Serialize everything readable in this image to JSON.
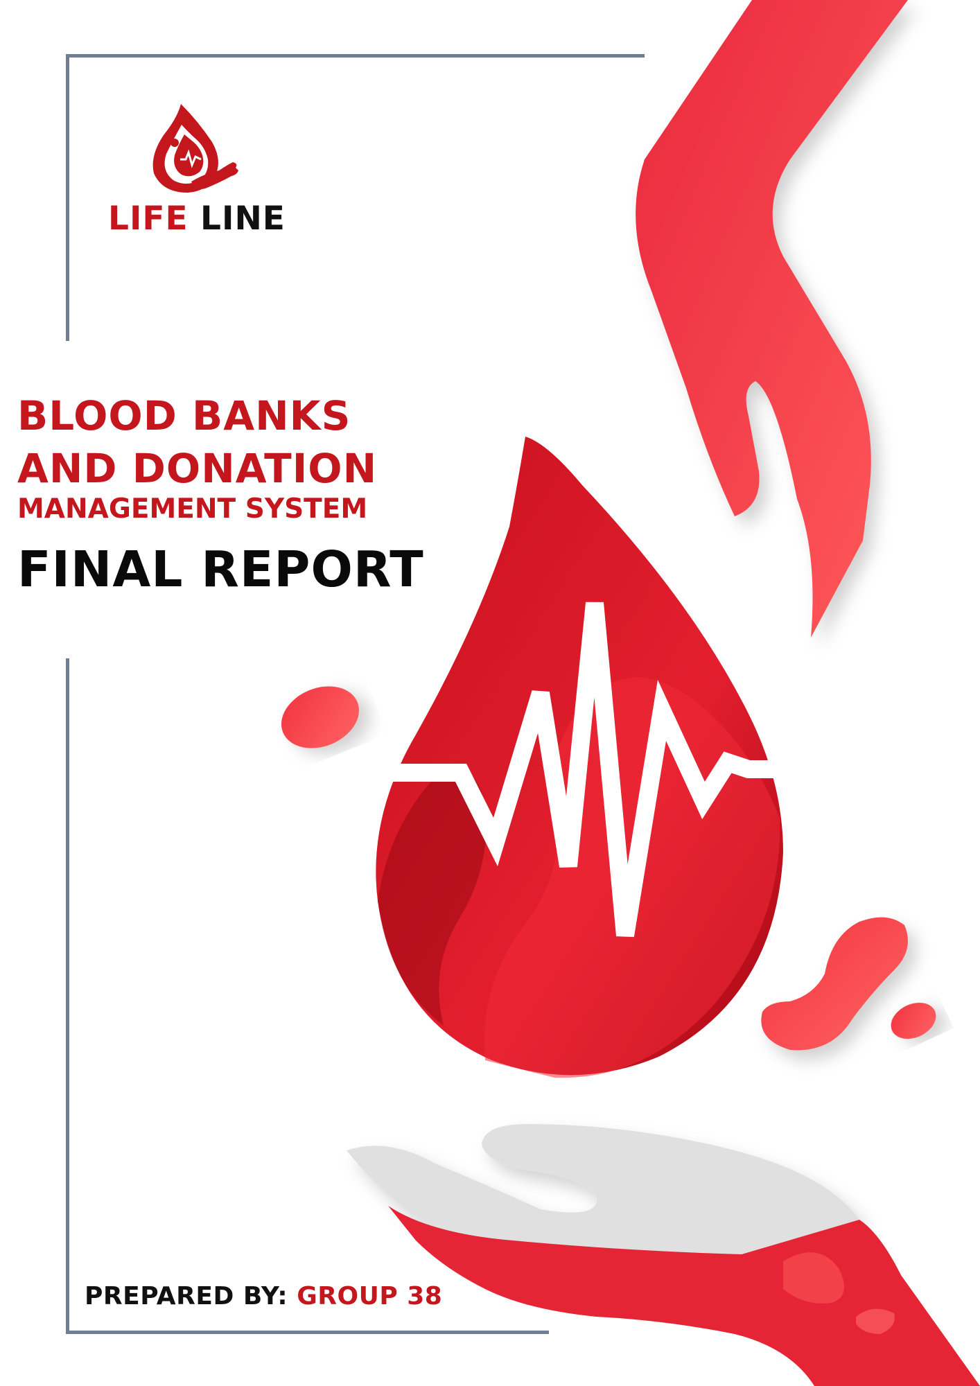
{
  "logo": {
    "word_1": "LIFE",
    "word_2": "LINE"
  },
  "title": {
    "line_1": "BLOOD BANKS",
    "line_2": "AND DONATION",
    "line_3": "MANAGEMENT SYSTEM"
  },
  "report_title": "FINAL REPORT",
  "prepared": {
    "label": "PREPARED BY:",
    "group": "GROUP 38"
  },
  "colors": {
    "brand_red": "#c3161d",
    "frame": "#6f7e92"
  },
  "icons": [
    "blood-drop-logo-icon",
    "blood-drop-heartbeat-icon",
    "hand-icon"
  ]
}
